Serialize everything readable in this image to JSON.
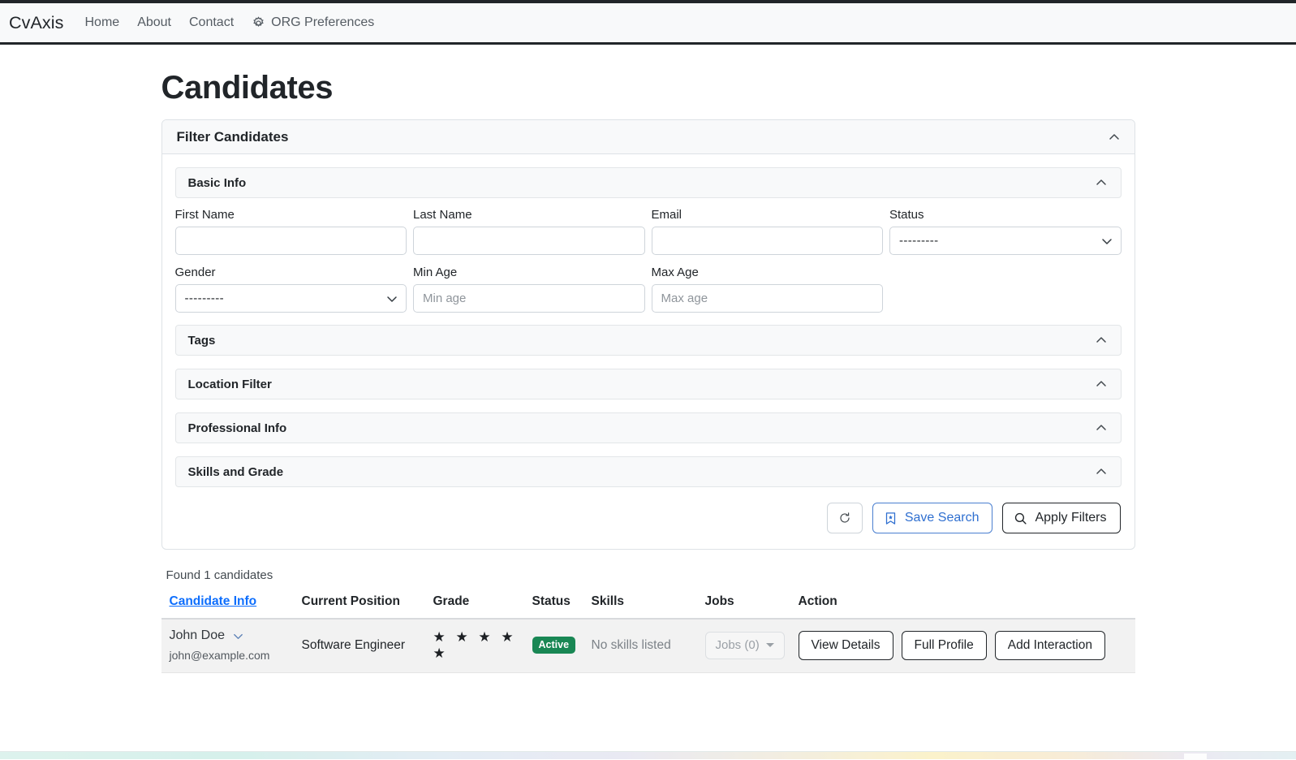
{
  "navbar": {
    "brand": "CvAxis",
    "links": [
      {
        "label": "Home",
        "icon": null
      },
      {
        "label": "About",
        "icon": null
      },
      {
        "label": "Contact",
        "icon": null
      },
      {
        "label": "ORG Preferences",
        "icon": "gear-icon"
      }
    ]
  },
  "page": {
    "title": "Candidates"
  },
  "filter_card": {
    "title": "Filter Candidates",
    "collapse_icon": "chevron-up-icon",
    "sections": [
      {
        "title": "Basic Info",
        "collapse_icon": "chevron-up-icon"
      },
      {
        "title": "Tags",
        "collapse_icon": "chevron-up-icon"
      },
      {
        "title": "Location Filter",
        "collapse_icon": "chevron-up-icon"
      },
      {
        "title": "Professional Info",
        "collapse_icon": "chevron-up-icon"
      },
      {
        "title": "Skills and Grade",
        "collapse_icon": "chevron-up-icon"
      }
    ],
    "fields": {
      "first_name": {
        "label": "First Name",
        "value": "",
        "placeholder": ""
      },
      "last_name": {
        "label": "Last Name",
        "value": "",
        "placeholder": ""
      },
      "email": {
        "label": "Email",
        "value": "",
        "placeholder": ""
      },
      "status": {
        "label": "Status",
        "value": "---------",
        "options": [
          "---------"
        ]
      },
      "gender": {
        "label": "Gender",
        "value": "---------",
        "options": [
          "---------"
        ]
      },
      "min_age": {
        "label": "Min Age",
        "value": "",
        "placeholder": "Min age"
      },
      "max_age": {
        "label": "Max Age",
        "value": "",
        "placeholder": "Max age"
      }
    },
    "buttons": {
      "reset": {
        "label": "",
        "icon": "reset-icon"
      },
      "save_search": {
        "label": "Save Search",
        "icon": "bookmark-star-icon",
        "color": "#2f6fd0"
      },
      "apply_filters": {
        "label": "Apply Filters",
        "icon": "search-icon",
        "color": "#212529"
      }
    }
  },
  "results": {
    "found_text": "Found 1 candidates",
    "columns": [
      "Candidate Info",
      "Current Position",
      "Grade",
      "Status",
      "Skills",
      "Jobs",
      "Action"
    ],
    "rows": [
      {
        "name": "John Doe",
        "email": "john@example.com",
        "expand_icon": "chevron-down-icon",
        "current_position": "Software Engineer",
        "grade_stars": "★ ★ ★ ★ ★",
        "grade_value": 5,
        "status": "Active",
        "status_color": "#198754",
        "skills": "No skills listed",
        "jobs_label": "Jobs (0)",
        "jobs_count": 0,
        "actions": [
          "View Details",
          "Full Profile",
          "Add Interaction"
        ]
      }
    ]
  }
}
